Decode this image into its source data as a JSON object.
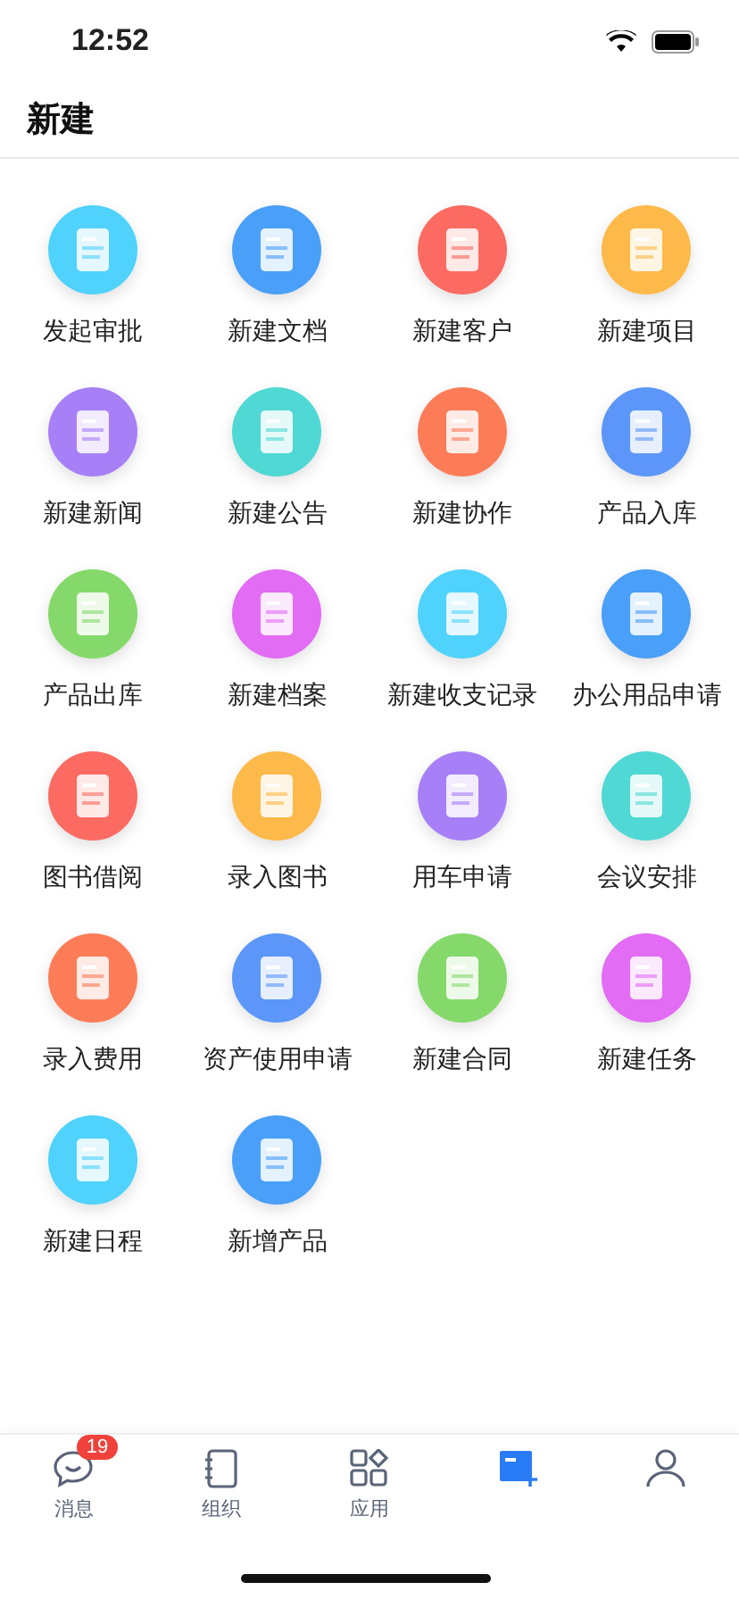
{
  "status_bar": {
    "time": "12:52"
  },
  "title": "新建",
  "items": [
    {
      "label": "发起审批",
      "color": "#4fd2fb"
    },
    {
      "label": "新建文档",
      "color": "#4a9ff8"
    },
    {
      "label": "新建客户",
      "color": "#fb6b62"
    },
    {
      "label": "新建项目",
      "color": "#fdb949"
    },
    {
      "label": "新建新闻",
      "color": "#a77ff6"
    },
    {
      "label": "新建公告",
      "color": "#4fd8d4"
    },
    {
      "label": "新建协作",
      "color": "#fd7c58"
    },
    {
      "label": "产品入库",
      "color": "#5c96f8"
    },
    {
      "label": "产品出库",
      "color": "#84d96a"
    },
    {
      "label": "新建档案",
      "color": "#e26cf4"
    },
    {
      "label": "新建收支记录",
      "color": "#4fd2fb"
    },
    {
      "label": "办公用品申请",
      "color": "#4a9ff8"
    },
    {
      "label": "图书借阅",
      "color": "#fb6b62"
    },
    {
      "label": "录入图书",
      "color": "#fdb949"
    },
    {
      "label": "用车申请",
      "color": "#a77ff6"
    },
    {
      "label": "会议安排",
      "color": "#4fd8d4"
    },
    {
      "label": "录入费用",
      "color": "#fd7c58"
    },
    {
      "label": "资产使用申请",
      "color": "#5c96f8"
    },
    {
      "label": "新建合同",
      "color": "#84d96a"
    },
    {
      "label": "新建任务",
      "color": "#e26cf4"
    },
    {
      "label": "新建日程",
      "color": "#4fd2fb"
    },
    {
      "label": "新增产品",
      "color": "#4a9ff8"
    }
  ],
  "tabs": [
    {
      "kind": "chat",
      "label": "消息",
      "badge": "19",
      "selected": false
    },
    {
      "kind": "notebook",
      "label": "组织",
      "selected": false
    },
    {
      "kind": "apps",
      "label": "应用",
      "selected": false
    },
    {
      "kind": "new",
      "selected": true
    },
    {
      "kind": "person",
      "selected": false
    }
  ]
}
